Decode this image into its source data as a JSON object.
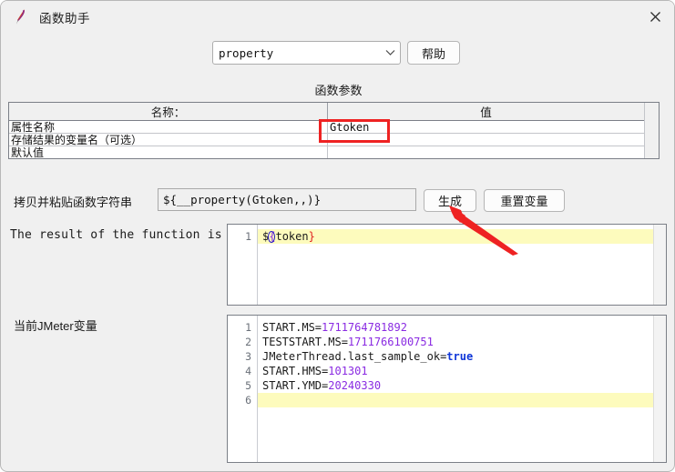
{
  "window": {
    "title": "函数助手",
    "app_icon": "jmeter-feather-icon",
    "close_icon": "close-icon"
  },
  "toolbar": {
    "function_select_value": "property",
    "function_select_icon": "chevron-down-icon",
    "help_label": "帮助"
  },
  "params_group": {
    "title": "函数参数",
    "columns": [
      "名称：",
      "值"
    ],
    "rows": [
      {
        "name": "属性名称",
        "value": "Gtoken"
      },
      {
        "name": "存储结果的变量名（可选）",
        "value": ""
      },
      {
        "name": "默认值",
        "value": ""
      }
    ]
  },
  "copy_row": {
    "label": "拷贝并粘贴函数字符串",
    "value": "${__property(Gtoken,,)}",
    "generate_label": "生成",
    "reset_label": "重置变量"
  },
  "result": {
    "label": "The result of the function is",
    "line_numbers": [
      "1"
    ],
    "text_prefix": "$",
    "brace_open": "{",
    "text_body": "token",
    "brace_close": "}"
  },
  "variables": {
    "label": "当前JMeter变量",
    "line_numbers": [
      "1",
      "2",
      "3",
      "4",
      "5",
      "6"
    ],
    "rows": [
      {
        "key": "START.MS=",
        "value": "1711764781892",
        "kind": "num"
      },
      {
        "key": "TESTSTART.MS=",
        "value": "1711766100751",
        "kind": "num"
      },
      {
        "key": "JMeterThread.last_sample_ok=",
        "value": "true",
        "kind": "bool"
      },
      {
        "key": "START.HMS=",
        "value": "101301",
        "kind": "num"
      },
      {
        "key": "START.YMD=",
        "value": "20240330",
        "kind": "num"
      },
      {
        "key": "",
        "value": "",
        "kind": "empty"
      }
    ]
  },
  "annotations": {
    "highlight_box_name": "gtoken-highlight-box",
    "arrow_name": "generate-button-arrow",
    "color": "#ee2222"
  }
}
